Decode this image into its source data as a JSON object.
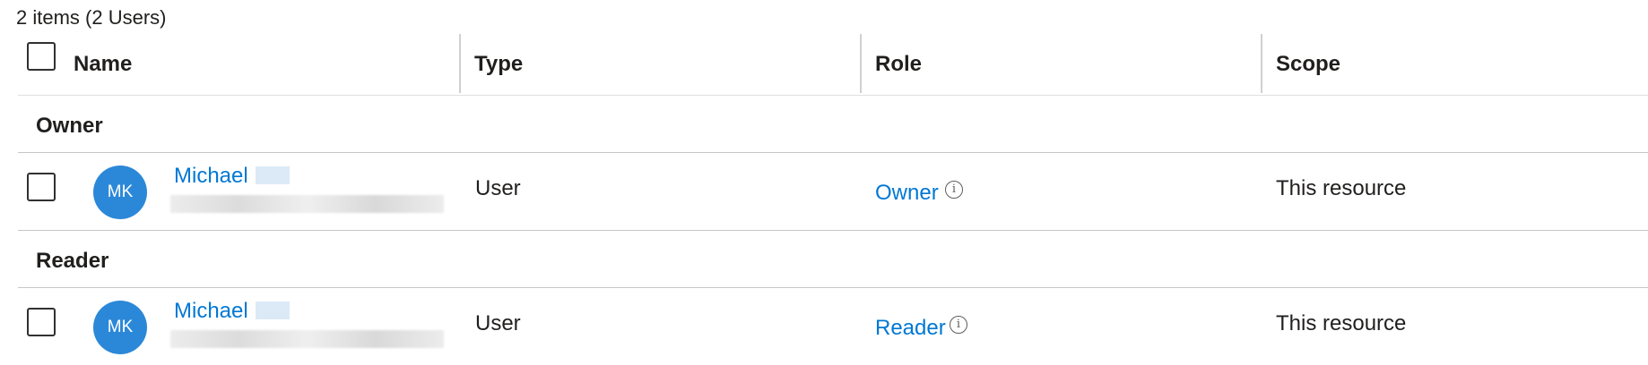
{
  "summary": "2 items (2 Users)",
  "columns": {
    "name": "Name",
    "type": "Type",
    "role": "Role",
    "scope": "Scope"
  },
  "groups": [
    {
      "label": "Owner",
      "rows": [
        {
          "initials": "MK",
          "name": "Michael",
          "type": "User",
          "role": "Owner",
          "scope": "This resource"
        }
      ]
    },
    {
      "label": "Reader",
      "rows": [
        {
          "initials": "MK",
          "name": "Michael",
          "type": "User",
          "role": "Reader",
          "scope": "This resource"
        }
      ]
    }
  ],
  "icons": {
    "info": "info-circle-icon",
    "checkbox": "checkbox-unchecked"
  },
  "colors": {
    "link": "#0078d4",
    "avatar": "#2b88d8",
    "text": "#201f1e"
  }
}
